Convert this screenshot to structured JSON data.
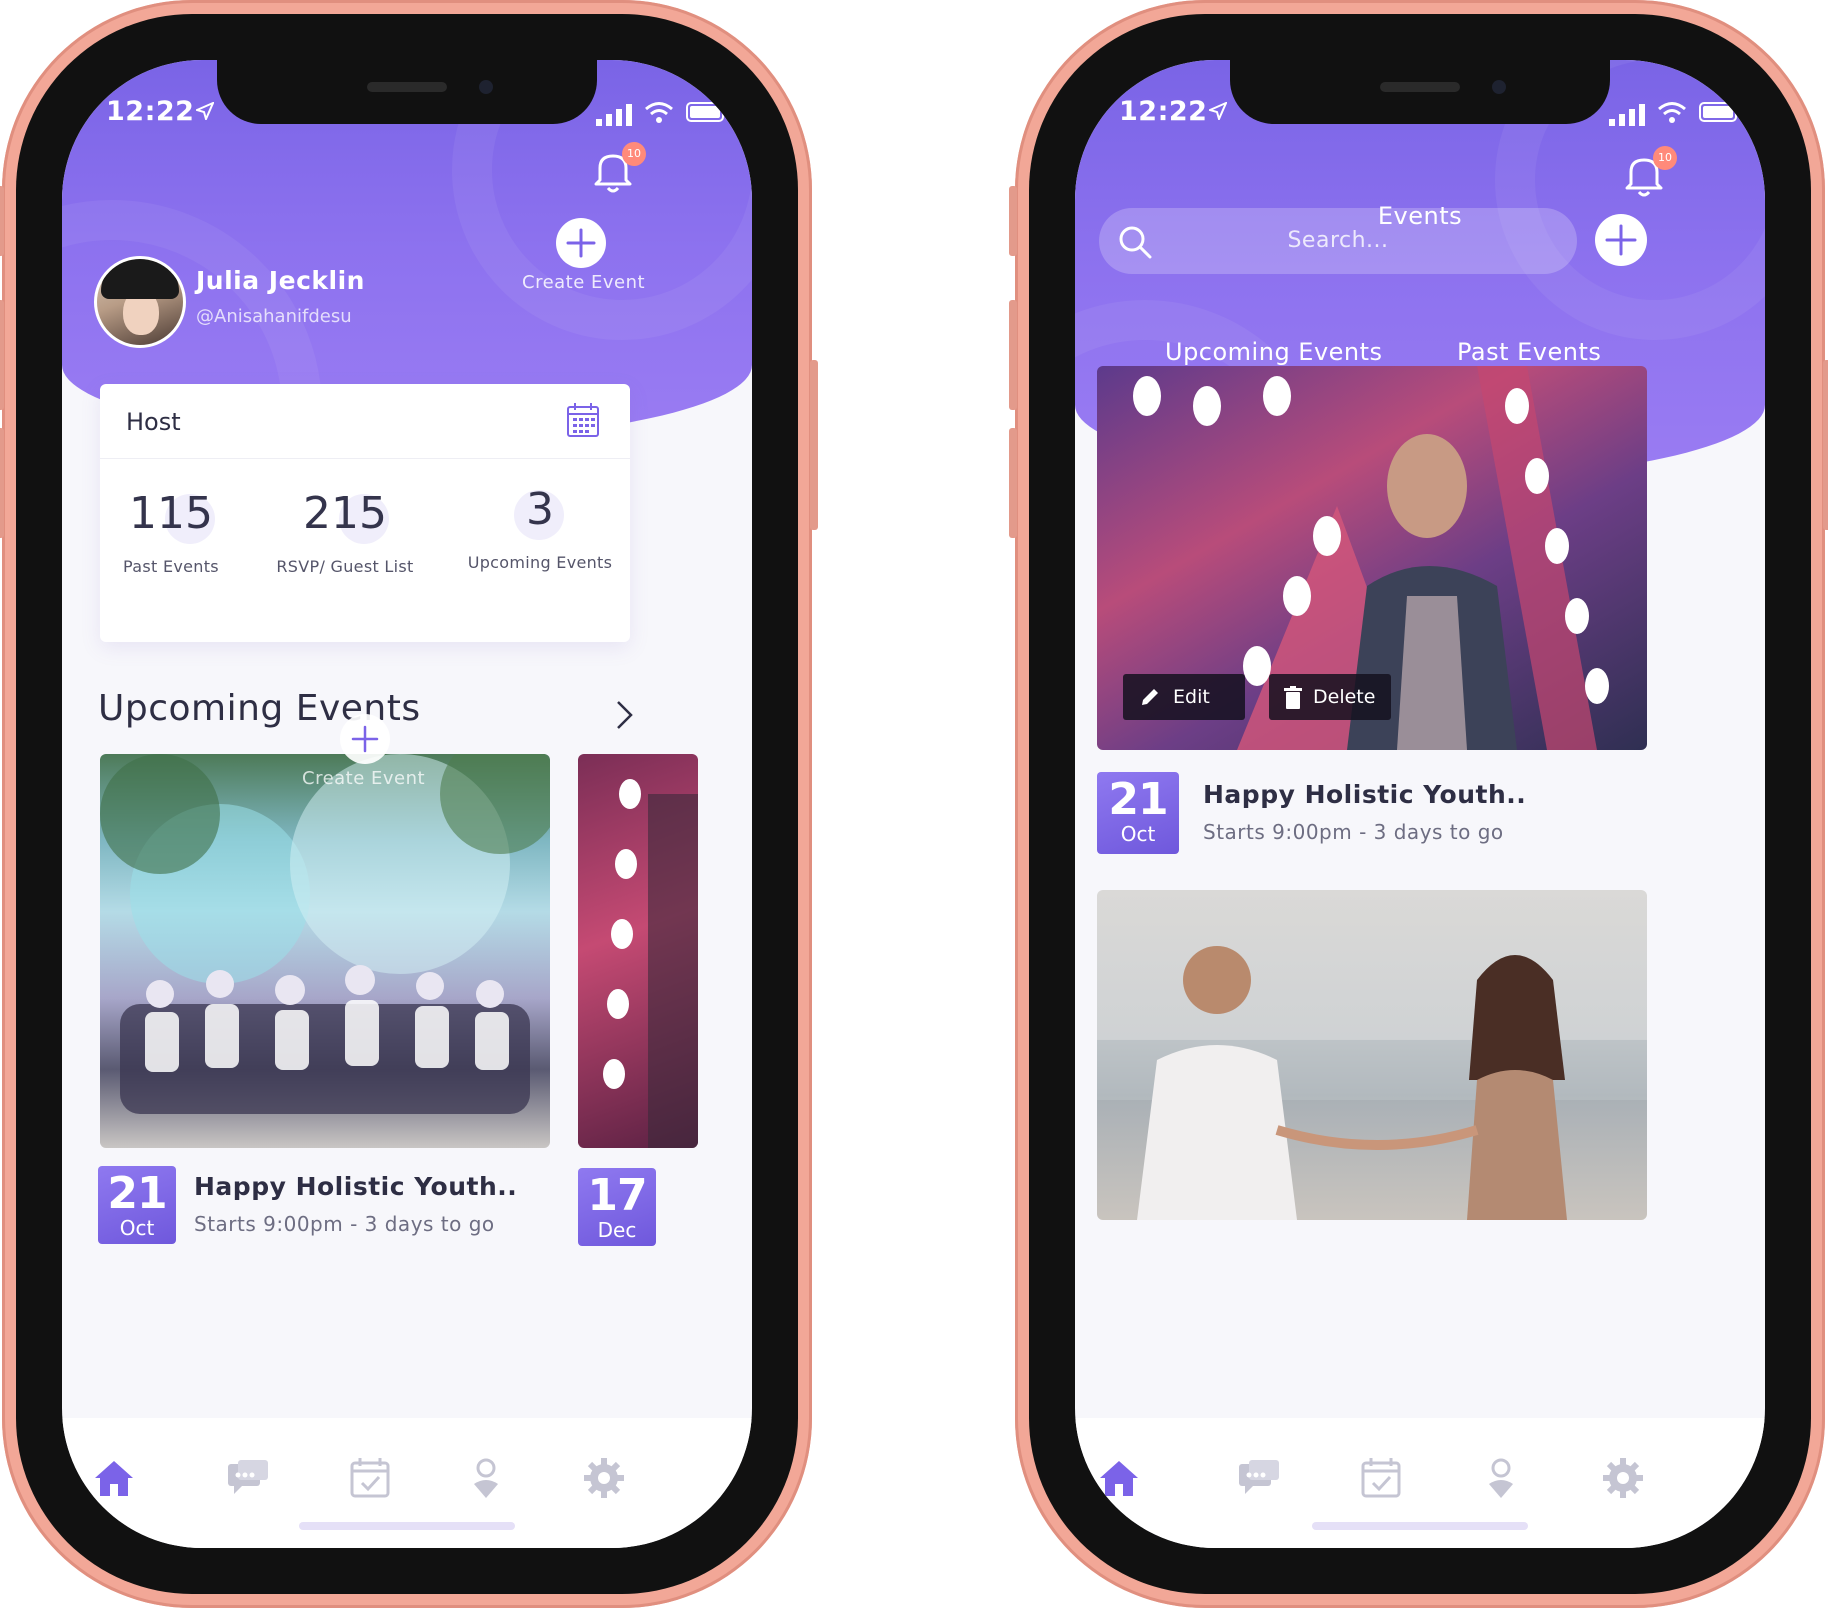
{
  "status": {
    "time": "12:22"
  },
  "left": {
    "notifications_count": "10",
    "profile": {
      "name": "Julia Jecklin",
      "handle": "@Anisahanifdesu"
    },
    "create_event_label": "Create Event",
    "host_card": {
      "title": "Host",
      "stats": [
        {
          "value": "115",
          "label": "Past Events"
        },
        {
          "value": "215",
          "label": "RSVP/ Guest List"
        },
        {
          "value": "3",
          "label": "Upcoming Events"
        }
      ]
    },
    "section_title": "Upcoming Events",
    "overlay_create_label": "Create Event",
    "events": [
      {
        "day": "21",
        "month": "Oct",
        "title": "Happy Holistic Youth..",
        "subtitle": "Starts 9:00pm - 3 days to go"
      },
      {
        "day": "17",
        "month": "Dec"
      }
    ]
  },
  "right": {
    "title": "Events",
    "notifications_count": "10",
    "search_placeholder": "Search...",
    "tabs": [
      {
        "label": "Upcoming Events",
        "active": true
      },
      {
        "label": "Past Events",
        "active": false
      }
    ],
    "event_actions": {
      "edit": "Edit",
      "delete": "Delete"
    },
    "events": [
      {
        "day": "21",
        "month": "Oct",
        "title": "Happy Holistic Youth..",
        "subtitle": "Starts 9:00pm - 3 days to go"
      }
    ]
  },
  "tabbar": [
    {
      "icon": "home-icon",
      "active": true
    },
    {
      "icon": "chat-icon",
      "active": false
    },
    {
      "icon": "calendar-check-icon",
      "active": false
    },
    {
      "icon": "location-pin-icon",
      "active": false
    },
    {
      "icon": "settings-gear-icon",
      "active": false
    }
  ],
  "colors": {
    "accent": "#7b63e8",
    "frame": "#f2a797",
    "inactive_icon": "#c5c5d3"
  }
}
